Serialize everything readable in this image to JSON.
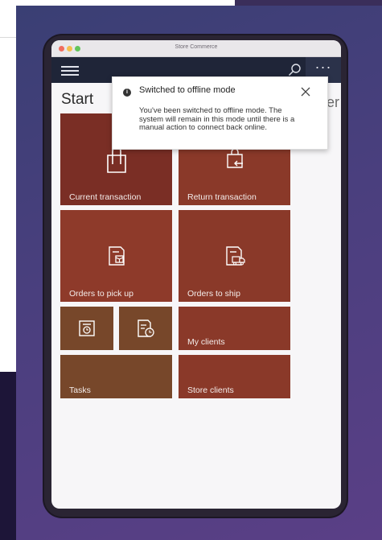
{
  "window": {
    "title": "Store Commerce"
  },
  "page": {
    "title": "Start",
    "right_clip": "er"
  },
  "notification": {
    "title": "Switched to offline mode",
    "body": "You've been switched to offline mode. The system will remain in this mode until there is a manual action to connect back online."
  },
  "tiles": [
    {
      "label": "Current transaction",
      "icon": "shopping-bag-icon"
    },
    {
      "label": "Return transaction",
      "icon": "return-bag-icon"
    },
    {
      "label": "Orders to pick up",
      "icon": "pickup-order-icon"
    },
    {
      "label": "Orders to ship",
      "icon": "ship-order-icon"
    },
    {
      "label": "",
      "icon": "register-icon"
    },
    {
      "label": "",
      "icon": "timesheet-icon"
    },
    {
      "label": "My clients",
      "icon": ""
    },
    {
      "label": "Tasks",
      "icon": ""
    },
    {
      "label": "Store clients",
      "icon": ""
    }
  ],
  "colors": {
    "appbar": "#1f2538",
    "tile_red": "#8a3929",
    "tile_dark_red": "#7a2e25",
    "tile_brown": "#77472a",
    "background_purple": "#4a3f7e"
  }
}
